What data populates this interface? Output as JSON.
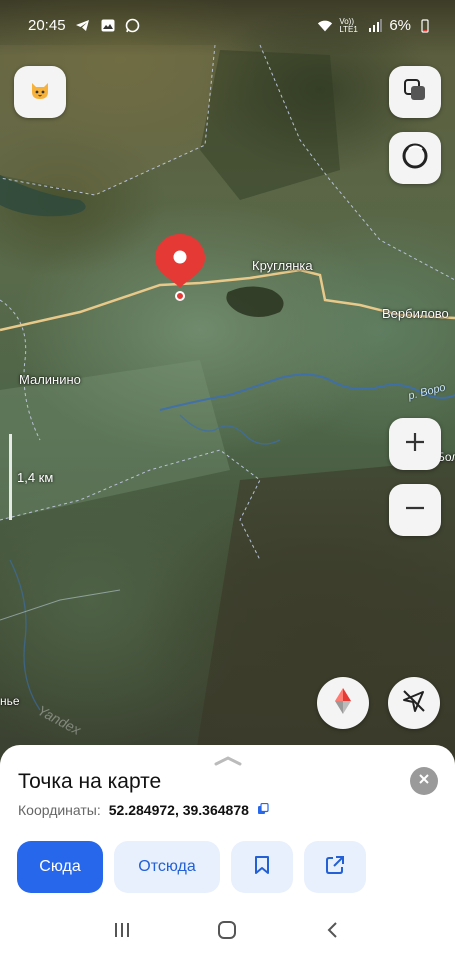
{
  "status_bar": {
    "time": "20:45",
    "network": "Vo)) LTE1",
    "battery": "6%",
    "icons": [
      "telegram-icon",
      "image-icon",
      "whatsapp-icon",
      "wifi-icon",
      "signal-icon",
      "battery-icon"
    ]
  },
  "map": {
    "labels": {
      "village_1": "Круглянка",
      "village_2": "Вербилово",
      "village_3": "Малинино",
      "river": "р. Воро",
      "edge_right": "Бол",
      "edge_left": "нье",
      "watermark": "Yandex"
    },
    "scale_text": "1,4 км",
    "pin_color": "#e53935",
    "controls": [
      "cat-avatar-icon",
      "layers-icon",
      "alice-icon",
      "zoom-in-icon",
      "zoom-out-icon",
      "compass-icon",
      "location-off-icon"
    ]
  },
  "sheet": {
    "title": "Точка на карте",
    "coords_label": "Координаты:",
    "coords_value": "52.284972, 39.364878",
    "buttons": {
      "to_here": "Сюда",
      "from_here": "Отсюда",
      "bookmark": "bookmark-icon",
      "share": "share-icon"
    }
  },
  "colors": {
    "accent": "#2667ec",
    "accent_light": "#e8f0fd",
    "road": "#e8c98a"
  }
}
